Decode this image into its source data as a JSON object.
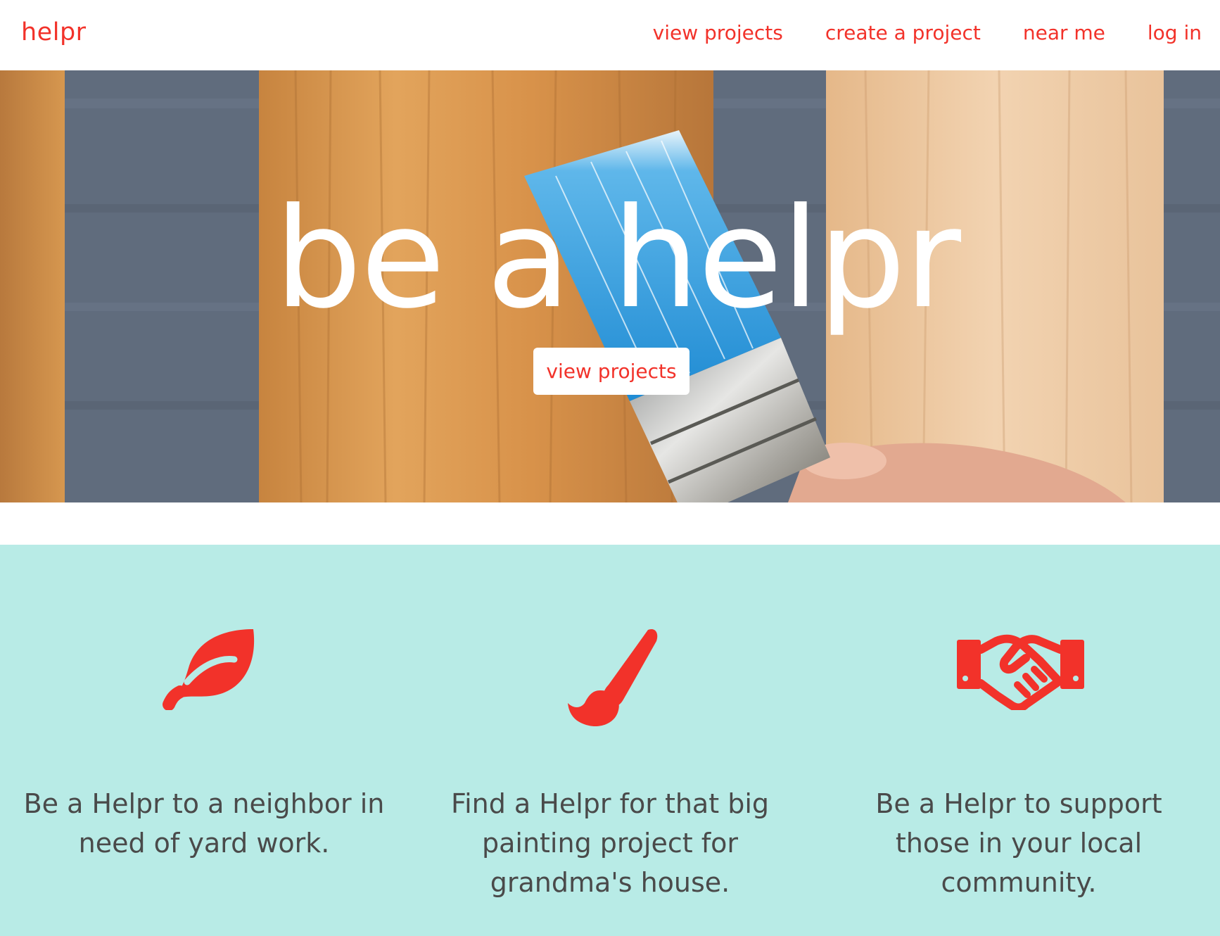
{
  "nav": {
    "brand": "helpr",
    "links": [
      "view projects",
      "create a project",
      "near me",
      "log in"
    ]
  },
  "hero": {
    "title": "be a helpr",
    "button_label": "view projects"
  },
  "features": [
    {
      "icon": "leaf-icon",
      "text": "Be a Helpr to a neighbor in need of yard work."
    },
    {
      "icon": "paintbrush-icon",
      "text": "Find a Helpr for that big painting project for grandma's house."
    },
    {
      "icon": "handshake-icon",
      "text": "Be a Helpr to support those in your local community."
    }
  ],
  "colors": {
    "accent": "#f2322a",
    "features_bg": "#b8ebe6",
    "text": "#4a4a4a"
  }
}
